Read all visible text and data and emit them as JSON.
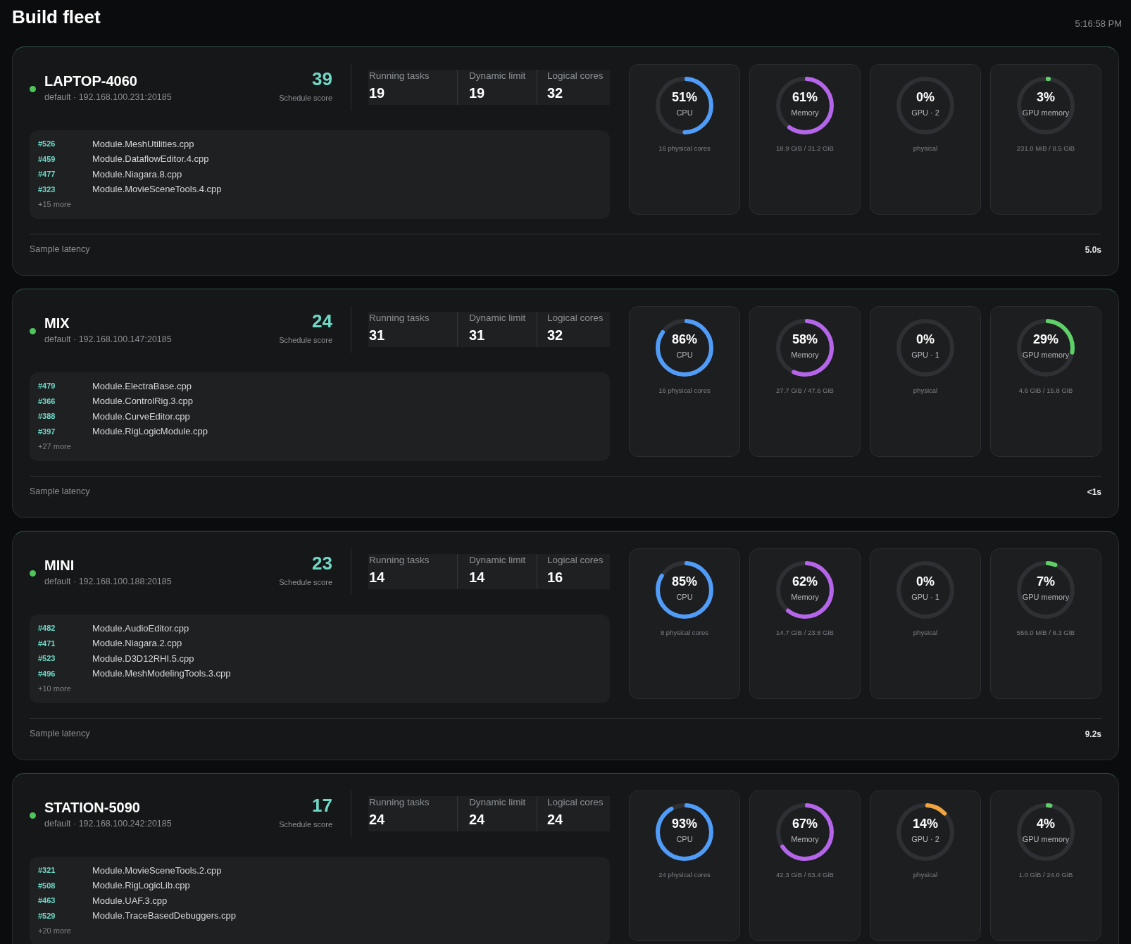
{
  "title": "Build fleet",
  "time": "5:16:58 PM",
  "hosts": [
    {
      "name": "LAPTOP-4060",
      "online": true,
      "address": "default · 192.168.100.231:20185",
      "score": "39",
      "score_label": "Schedule score",
      "stats": [
        {
          "label": "Running tasks",
          "value": "19"
        },
        {
          "label": "Dynamic limit",
          "value": "19"
        },
        {
          "label": "Logical cores",
          "value": "32"
        }
      ],
      "tasks": [
        {
          "id": "#526",
          "file": "Module.MeshUtilities.cpp"
        },
        {
          "id": "#459",
          "file": "Module.DataflowEditor.4.cpp"
        },
        {
          "id": "#477",
          "file": "Module.Niagara.8.cpp"
        },
        {
          "id": "#323",
          "file": "Module.MovieSceneTools.4.cpp"
        }
      ],
      "more": "+15 more",
      "gauges": [
        {
          "kind": "cpu",
          "percent": "51%",
          "label": "CPU",
          "level": 0.51,
          "detail": "16 physical cores"
        },
        {
          "kind": "memory",
          "percent": "61%",
          "label": "Memory",
          "level": 0.61,
          "detail": "18.9 GiB / 31.2 GiB"
        },
        {
          "kind": "gpu",
          "percent": "0%",
          "label": "GPU · 2",
          "level": 0,
          "detail": "physical"
        },
        {
          "kind": "gpu_memory",
          "percent": "3%",
          "label": "GPU memory",
          "level": 0.03,
          "detail": "231.0 MiB / 8.5 GiB"
        }
      ],
      "latency_label": "Sample latency",
      "latency": "5.0s"
    },
    {
      "name": "MIX",
      "online": true,
      "address": "default · 192.168.100.147:20185",
      "score": "24",
      "score_label": "Schedule score",
      "stats": [
        {
          "label": "Running tasks",
          "value": "31"
        },
        {
          "label": "Dynamic limit",
          "value": "31"
        },
        {
          "label": "Logical cores",
          "value": "32"
        }
      ],
      "tasks": [
        {
          "id": "#479",
          "file": "Module.ElectraBase.cpp"
        },
        {
          "id": "#366",
          "file": "Module.ControlRig.3.cpp"
        },
        {
          "id": "#388",
          "file": "Module.CurveEditor.cpp"
        },
        {
          "id": "#397",
          "file": "Module.RigLogicModule.cpp"
        }
      ],
      "more": "+27 more",
      "gauges": [
        {
          "kind": "cpu",
          "percent": "86%",
          "label": "CPU",
          "level": 0.86,
          "detail": "16 physical cores"
        },
        {
          "kind": "memory",
          "percent": "58%",
          "label": "Memory",
          "level": 0.58,
          "detail": "27.7 GiB / 47.6 GiB"
        },
        {
          "kind": "gpu",
          "percent": "0%",
          "label": "GPU · 1",
          "level": 0,
          "detail": "physical"
        },
        {
          "kind": "gpu_memory",
          "percent": "29%",
          "label": "GPU memory",
          "level": 0.29,
          "detail": "4.6 GiB / 15.8 GiB"
        }
      ],
      "latency_label": "Sample latency",
      "latency": "<1s"
    },
    {
      "name": "MINI",
      "online": true,
      "address": "default · 192.168.100.188:20185",
      "score": "23",
      "score_label": "Schedule score",
      "stats": [
        {
          "label": "Running tasks",
          "value": "14"
        },
        {
          "label": "Dynamic limit",
          "value": "14"
        },
        {
          "label": "Logical cores",
          "value": "16"
        }
      ],
      "tasks": [
        {
          "id": "#482",
          "file": "Module.AudioEditor.cpp"
        },
        {
          "id": "#471",
          "file": "Module.Niagara.2.cpp"
        },
        {
          "id": "#523",
          "file": "Module.D3D12RHI.5.cpp"
        },
        {
          "id": "#496",
          "file": "Module.MeshModelingTools.3.cpp"
        }
      ],
      "more": "+10 more",
      "gauges": [
        {
          "kind": "cpu",
          "percent": "85%",
          "label": "CPU",
          "level": 0.85,
          "detail": "8 physical cores"
        },
        {
          "kind": "memory",
          "percent": "62%",
          "label": "Memory",
          "level": 0.62,
          "detail": "14.7 GiB / 23.8 GiB"
        },
        {
          "kind": "gpu",
          "percent": "0%",
          "label": "GPU · 1",
          "level": 0,
          "detail": "physical"
        },
        {
          "kind": "gpu_memory",
          "percent": "7%",
          "label": "GPU memory",
          "level": 0.07,
          "detail": "556.0 MiB / 8.3 GiB"
        }
      ],
      "latency_label": "Sample latency",
      "latency": "9.2s"
    },
    {
      "name": "STATION-5090",
      "online": true,
      "address": "default · 192.168.100.242:20185",
      "score": "17",
      "score_label": "Schedule score",
      "stats": [
        {
          "label": "Running tasks",
          "value": "24"
        },
        {
          "label": "Dynamic limit",
          "value": "24"
        },
        {
          "label": "Logical cores",
          "value": "24"
        }
      ],
      "tasks": [
        {
          "id": "#321",
          "file": "Module.MovieSceneTools.2.cpp"
        },
        {
          "id": "#508",
          "file": "Module.RigLogicLib.cpp"
        },
        {
          "id": "#463",
          "file": "Module.UAF.3.cpp"
        },
        {
          "id": "#529",
          "file": "Module.TraceBasedDebuggers.cpp"
        }
      ],
      "more": "+20 more",
      "gauges": [
        {
          "kind": "cpu",
          "percent": "93%",
          "label": "CPU",
          "level": 0.93,
          "detail": "24 physical cores"
        },
        {
          "kind": "memory",
          "percent": "67%",
          "label": "Memory",
          "level": 0.67,
          "detail": "42.3 GiB / 63.4 GiB"
        },
        {
          "kind": "gpu",
          "percent": "14%",
          "label": "GPU · 2",
          "level": 0.14,
          "detail": "physical"
        },
        {
          "kind": "gpu_memory",
          "percent": "4%",
          "label": "GPU memory",
          "level": 0.04,
          "detail": "1.0 GiB / 24.0 GiB"
        }
      ]
    }
  ]
}
